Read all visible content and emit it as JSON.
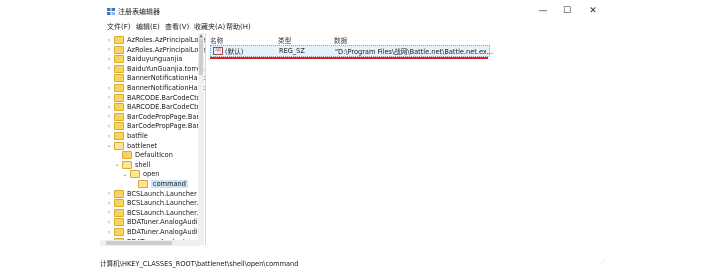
{
  "window": {
    "title": "注册表编辑器",
    "minimize": "—",
    "maximize": "☐",
    "close": "✕"
  },
  "menu": [
    "文件(F)",
    "编辑(E)",
    "查看(V)",
    "收藏夹(A)",
    "帮助(H)"
  ],
  "tree": [
    {
      "label": "AzRoles.AzPrincipalLoca",
      "depth": 0,
      "expander": "›"
    },
    {
      "label": "AzRoles.AzPrincipalLoca",
      "depth": 0,
      "expander": "›"
    },
    {
      "label": "Baiduyunguanjia",
      "depth": 0,
      "expander": "›"
    },
    {
      "label": "BaiduYunGuanjia.torren",
      "depth": 0,
      "expander": "›"
    },
    {
      "label": "BannerNotificationHanc",
      "depth": 0,
      "expander": ""
    },
    {
      "label": "BannerNotificationHanc",
      "depth": 0,
      "expander": "›"
    },
    {
      "label": "BARCODE.BarCodeCtrl",
      "depth": 0,
      "expander": "›"
    },
    {
      "label": "BARCODE.BarCodeCtrl.",
      "depth": 0,
      "expander": "›"
    },
    {
      "label": "BarCodePropPage.BarC",
      "depth": 0,
      "expander": "›"
    },
    {
      "label": "BarCodePropPage.BarC",
      "depth": 0,
      "expander": "›"
    },
    {
      "label": "batfile",
      "depth": 0,
      "expander": "›"
    },
    {
      "label": "battlenet",
      "depth": 0,
      "expander": "⌄"
    },
    {
      "label": "DefaultIcon",
      "depth": 1,
      "expander": ""
    },
    {
      "label": "shell",
      "depth": 1,
      "expander": "⌄"
    },
    {
      "label": "open",
      "depth": 2,
      "expander": "⌄"
    },
    {
      "label": "command",
      "depth": 3,
      "expander": "",
      "selected": true
    },
    {
      "label": "BCSLaunch.Launcher",
      "depth": 0,
      "expander": "›"
    },
    {
      "label": "BCSLaunch.Launcher.1",
      "depth": 0,
      "expander": "›"
    },
    {
      "label": "BCSLaunch.Launcher.2",
      "depth": 0,
      "expander": "›"
    },
    {
      "label": "BDATuner.AnalogAudio",
      "depth": 0,
      "expander": "›"
    },
    {
      "label": "BDATuner.AnalogAudio",
      "depth": 0,
      "expander": "›"
    },
    {
      "label": "BDATuner.AnalogLocat",
      "depth": 0,
      "expander": "›"
    }
  ],
  "columns": {
    "name": "名称",
    "type": "类型",
    "data": "数据"
  },
  "values": [
    {
      "icon": "ab",
      "name": "(默认)",
      "type": "REG_SZ",
      "data": "\"D:\\Program Files\\战网\\Battle.net\\Battle.net.ex..."
    }
  ],
  "status": {
    "path": "计算机\\HKEY_CLASSES_ROOT\\battlenet\\shell\\open\\command"
  },
  "colors": {
    "highlight_underline": "#e02020",
    "selection": "#cce4f7",
    "folder": "#f6d363"
  },
  "icons": {
    "app": "registry-editor-icon",
    "value": "string-value-icon",
    "folder": "folder-icon"
  }
}
